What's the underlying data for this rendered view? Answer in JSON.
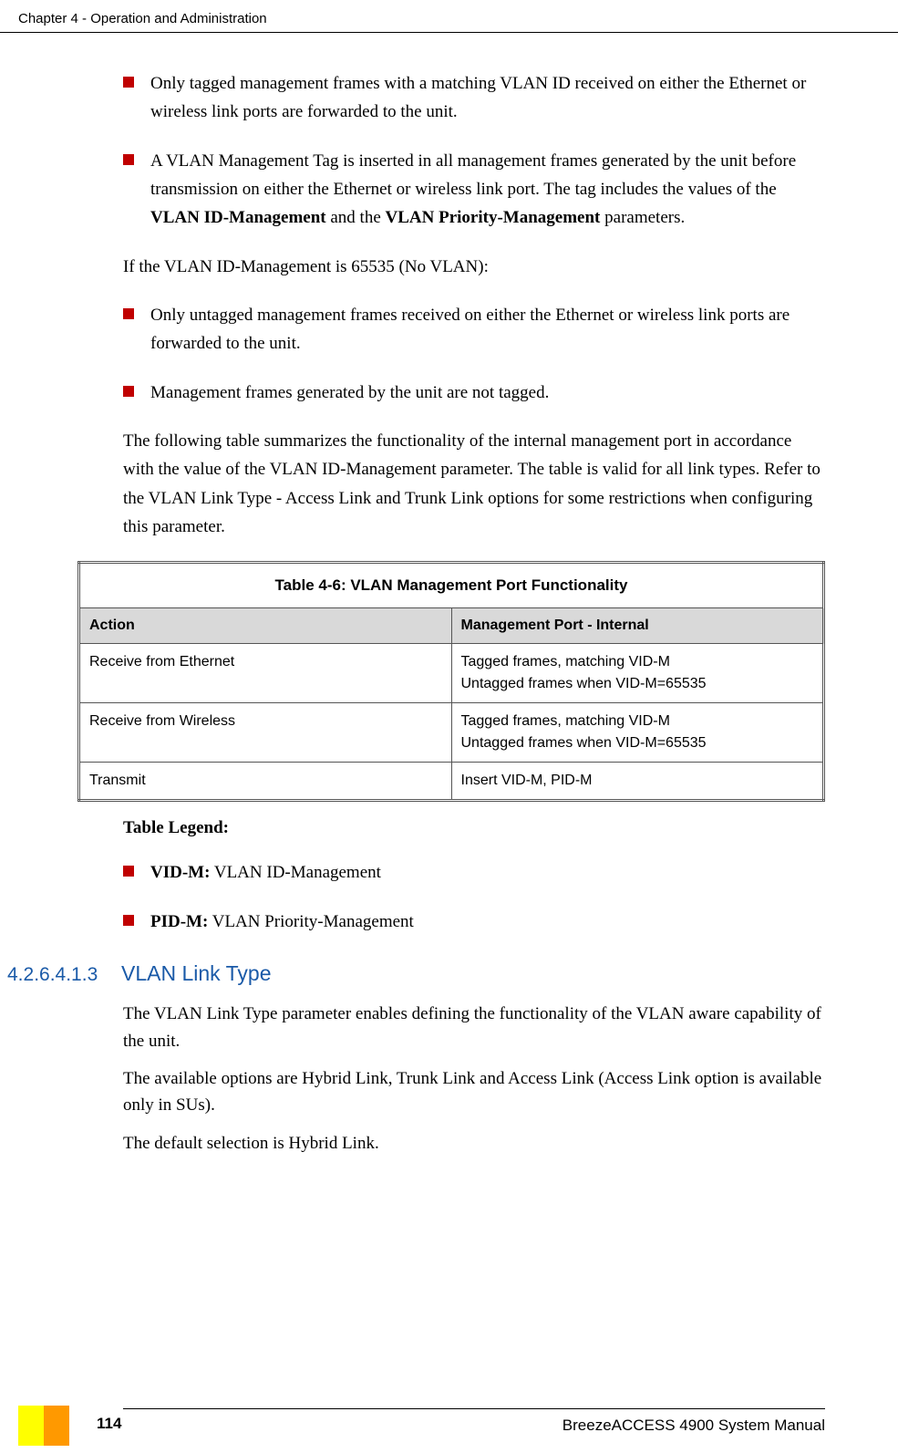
{
  "header": {
    "chapter": "Chapter 4 - Operation and Administration"
  },
  "body": {
    "bullet1": "Only tagged management frames with a matching VLAN ID received on either the Ethernet or wireless link ports are forwarded to the unit.",
    "bullet2_pre": "A VLAN Management Tag is inserted in all management frames generated by the unit before transmission on either the Ethernet or wireless link port. The tag includes the values of the ",
    "bullet2_b1": "VLAN ID-Management",
    "bullet2_mid": " and the ",
    "bullet2_b2": "VLAN Priority-Management",
    "bullet2_post": " parameters.",
    "para1": "If the VLAN ID-Management is 65535 (No VLAN):",
    "bullet3": "Only untagged management frames received on either the Ethernet or wireless link ports are forwarded to the unit.",
    "bullet4": "Management frames generated by the unit are not tagged.",
    "para2": "The following table summarizes the functionality of the internal management port in accordance with the value of the VLAN ID-Management parameter. The table is valid for all link types. Refer to the VLAN Link Type - Access Link and Trunk Link options for some restrictions when configuring this parameter."
  },
  "table": {
    "caption": "Table 4-6: VLAN Management Port Functionality",
    "head_action": "Action",
    "head_port": "Management Port - Internal",
    "rows": [
      {
        "action": "Receive from Ethernet",
        "port_l1": "Tagged frames, matching VID-M",
        "port_l2": "Untagged frames when VID-M=65535"
      },
      {
        "action": "Receive from Wireless",
        "port_l1": "Tagged frames, matching VID-M",
        "port_l2": "Untagged frames when VID-M=65535"
      },
      {
        "action": "Transmit",
        "port_l1": "Insert VID-M, PID-M",
        "port_l2": ""
      }
    ]
  },
  "legend": {
    "title": "Table Legend:",
    "vidm_b": "VID-M:",
    "vidm_t": " VLAN ID-Management",
    "pidm_b": "PID-M:",
    "pidm_t": " VLAN Priority-Management"
  },
  "section": {
    "num": "4.2.6.4.1.3",
    "title": "VLAN Link Type",
    "p1": "The VLAN Link Type parameter enables defining the functionality of the VLAN aware capability of the unit.",
    "p2": "The available options are Hybrid Link, Trunk Link and Access Link (Access Link option is available only in SUs).",
    "p3": "The default selection is Hybrid Link."
  },
  "footer": {
    "manual": "BreezeACCESS 4900 System Manual",
    "page": "114"
  }
}
